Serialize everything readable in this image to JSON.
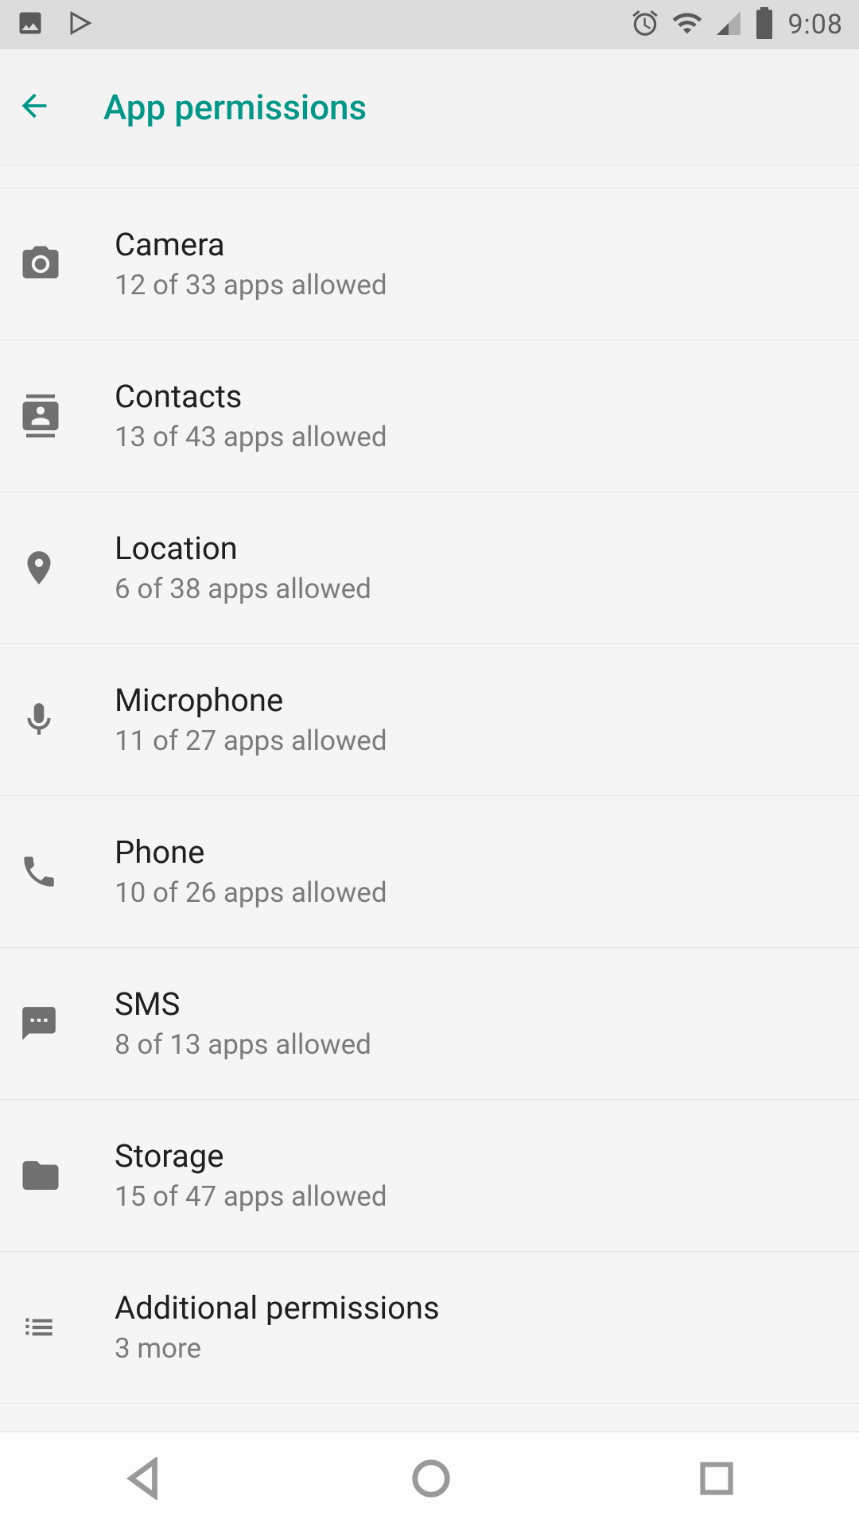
{
  "status": {
    "time": "9:08"
  },
  "header": {
    "title": "App permissions"
  },
  "permissions": [
    {
      "icon": "camera",
      "label": "Camera",
      "sub": "12 of 33 apps allowed"
    },
    {
      "icon": "contacts",
      "label": "Contacts",
      "sub": "13 of 43 apps allowed"
    },
    {
      "icon": "location",
      "label": "Location",
      "sub": "6 of 38 apps allowed"
    },
    {
      "icon": "microphone",
      "label": "Microphone",
      "sub": "11 of 27 apps allowed"
    },
    {
      "icon": "phone",
      "label": "Phone",
      "sub": "10 of 26 apps allowed"
    },
    {
      "icon": "sms",
      "label": "SMS",
      "sub": "8 of 13 apps allowed"
    },
    {
      "icon": "storage",
      "label": "Storage",
      "sub": "15 of 47 apps allowed"
    },
    {
      "icon": "more",
      "label": "Additional permissions",
      "sub": "3 more"
    }
  ]
}
